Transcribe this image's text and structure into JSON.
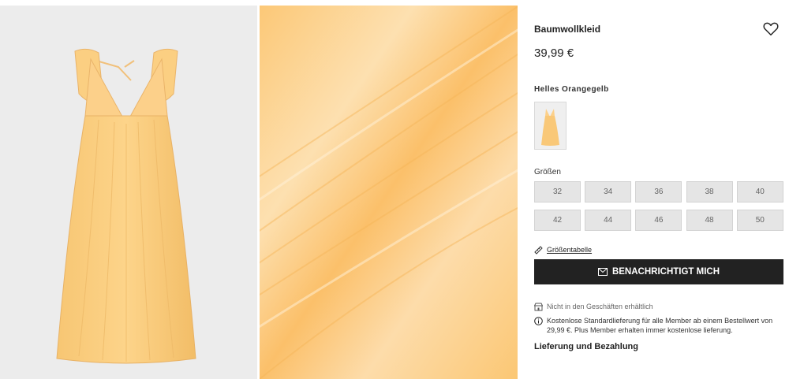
{
  "product": {
    "title": "Baumwollkleid",
    "price": "39,99 €",
    "color_name": "Helles Orangegelb",
    "accent_color": "#fcc877"
  },
  "sizes": {
    "label": "Größen",
    "options": [
      "32",
      "34",
      "36",
      "38",
      "40",
      "42",
      "44",
      "46",
      "48",
      "50"
    ]
  },
  "size_chart_link": "Größentabelle",
  "notify_button": "BENACHRICHTIGT MICH",
  "store_info": "Nicht in den Geschäften erhältlich",
  "delivery_info": "Kostenlose Standardlieferung für alle Member ab einem Bestellwert von 29,99 €. Plus Member erhalten immer kostenlose lieferung.",
  "delivery_heading": "Lieferung und Bezahlung",
  "icons": {
    "favorite": "heart-icon",
    "size_chart": "ruler-icon",
    "notify": "envelope-icon",
    "store": "store-icon",
    "delivery": "info-icon"
  }
}
